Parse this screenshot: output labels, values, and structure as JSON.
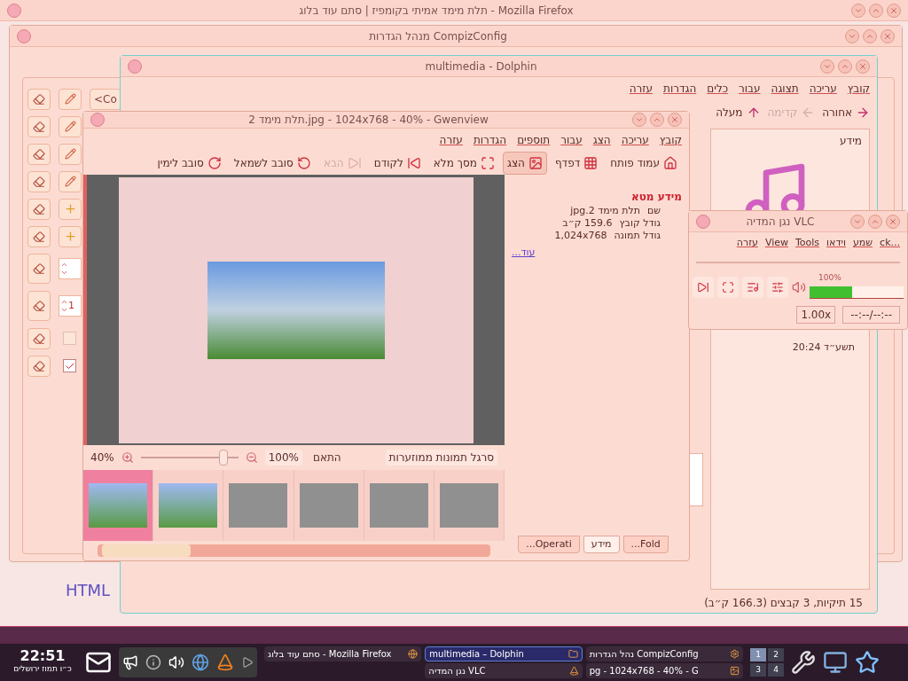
{
  "firefox": {
    "title": "תלת מימד אמיתי בקומפיז | סתם עוד בלוג - Mozilla Firefox",
    "page_text": "HTML"
  },
  "compiz": {
    "title": "מנהל הגדרות CompizConfig",
    "rows": [
      {
        "kind": "edit",
        "label": "<Co"
      },
      {
        "kind": "edit"
      },
      {
        "kind": "edit"
      },
      {
        "kind": "edit"
      },
      {
        "kind": "add"
      },
      {
        "kind": "add"
      },
      {
        "kind": "spin"
      },
      {
        "kind": "spin",
        "value": "1"
      },
      {
        "kind": "checkbox",
        "checked": false
      },
      {
        "kind": "checkbox",
        "checked": true
      }
    ]
  },
  "dolphin": {
    "title": "multimedia - Dolphin",
    "menu": [
      "קובץ",
      "עריכה",
      "תצוגה",
      "עבור",
      "כלים",
      "הגדרות",
      "עזרה"
    ],
    "nav": [
      {
        "label": "אחורה",
        "disabled": false
      },
      {
        "label": "קדימה",
        "disabled": true
      },
      {
        "label": "מעלה",
        "disabled": false
      }
    ],
    "panel_title": "מידע",
    "date": "20:24 תשע״ד",
    "status": "15 תיקיות, 3 קבצים (166.3 ק״ב)"
  },
  "gwenview": {
    "title": "תלת מימד 2.jpg - 1024x768 - 40% - Gwenview",
    "menu": [
      "קובץ",
      "עריכה",
      "הצג",
      "עבור",
      "תוספים",
      "הגדרות",
      "עזרה"
    ],
    "toolbar": [
      {
        "kind": "home",
        "label": "עמוד פותח",
        "selected": false,
        "disabled": false
      },
      {
        "kind": "browse",
        "label": "דפדף",
        "selected": false,
        "disabled": false
      },
      {
        "kind": "view",
        "label": "הצג",
        "selected": true,
        "disabled": false
      },
      {
        "kind": "fullscreen",
        "label": "מסך מלא",
        "selected": false,
        "disabled": false
      },
      {
        "kind": "prev",
        "label": "לקודם",
        "selected": false,
        "disabled": false
      },
      {
        "kind": "next",
        "label": "הבא",
        "selected": false,
        "disabled": true
      },
      {
        "kind": "rotate-left",
        "label": "סובב לשמאל",
        "selected": false,
        "disabled": false
      },
      {
        "kind": "rotate-right",
        "label": "סובב לימין",
        "selected": false,
        "disabled": false
      }
    ],
    "meta_title": "מידע מטא",
    "meta": [
      {
        "label": "שם",
        "value": "תלת מימד 2.jpg"
      },
      {
        "label": "גודל קובץ",
        "value": "159.6 ק״ב"
      },
      {
        "label": "גודל תמונה",
        "value": "1,024x768"
      }
    ],
    "more": "עוד...",
    "zoom": "40%",
    "zoom_slider": {
      "level": 0.85
    },
    "actual_size": "100%",
    "fit": "התאם",
    "thumbbar": "סרגל תמונות ממוזערות",
    "thumbnails": [
      {
        "selected": true
      },
      {
        "selected": false
      },
      {
        "selected": false
      },
      {
        "selected": false
      },
      {
        "selected": false
      },
      {
        "selected": false
      }
    ],
    "side_tabs": [
      {
        "label": "Fold...",
        "selected": false
      },
      {
        "label": "מידע",
        "selected": true
      },
      {
        "label": "Operati...",
        "selected": false
      }
    ]
  },
  "vlc": {
    "title": "נגן המדיה VLC",
    "menu": [
      "...ck",
      "שמע",
      "וידאו",
      "Tools",
      "View",
      "עזרה"
    ],
    "volume": {
      "level": 0.45,
      "reading": "100%"
    },
    "speed": "1.00x",
    "time": "--:--/--:--"
  },
  "taskbar": {
    "clock": "22:51",
    "date": "כ״ו תמוז ירושלים",
    "tasks": [
      {
        "label": "נהל הגדרות CompizConfig",
        "selected": false,
        "kind": "settings"
      },
      {
        "label": "multimedia – Dolphin",
        "selected": true,
        "kind": "folder"
      },
      {
        "label": "סתם עוד בלוג - Mozilla Firefox",
        "selected": false,
        "kind": "firefox"
      },
      {
        "label": "pg - 1024x768 - 40% - G",
        "selected": false,
        "kind": "image"
      },
      {
        "label": "נגן המדיה VLC",
        "selected": false,
        "kind": "vlc"
      }
    ],
    "pager": [
      {
        "label": "2",
        "selected": false
      },
      {
        "label": "1",
        "selected": true
      },
      {
        "label": "4",
        "selected": false
      },
      {
        "label": "3",
        "selected": false
      }
    ]
  }
}
